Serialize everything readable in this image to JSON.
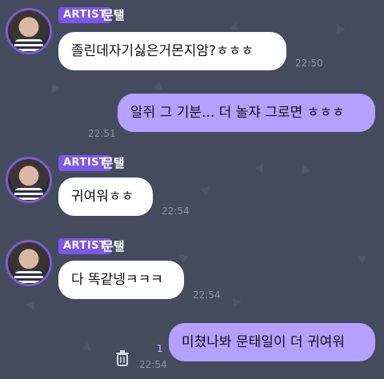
{
  "messages": [
    {
      "badge": "ARTIST",
      "sender": "문탤",
      "text": "졸린데자기싫은거몬지암?ㅎㅎㅎ",
      "time": "22:50"
    },
    {
      "text": "알쥐 그 기분... 더 놀쟈 그로면 ㅎㅎㅎ",
      "time": "22:51"
    },
    {
      "badge": "ARTIST",
      "sender": "문탤",
      "text": "귀여워ㅎㅎ",
      "time": "22:54"
    },
    {
      "badge": "ARTIST",
      "sender": "문탤",
      "text": "다 똑같넹ㅋㅋㅋ",
      "time": "22:54"
    },
    {
      "text": "미쳤나봐 문태일이 더 귀여워",
      "time": "22:54",
      "read_count": "1"
    }
  ],
  "colors": {
    "background": "#464a5d",
    "accent": "#7b57e8",
    "my_bubble": "#b4a0ff"
  },
  "icons": {
    "trash": "trash-icon"
  }
}
